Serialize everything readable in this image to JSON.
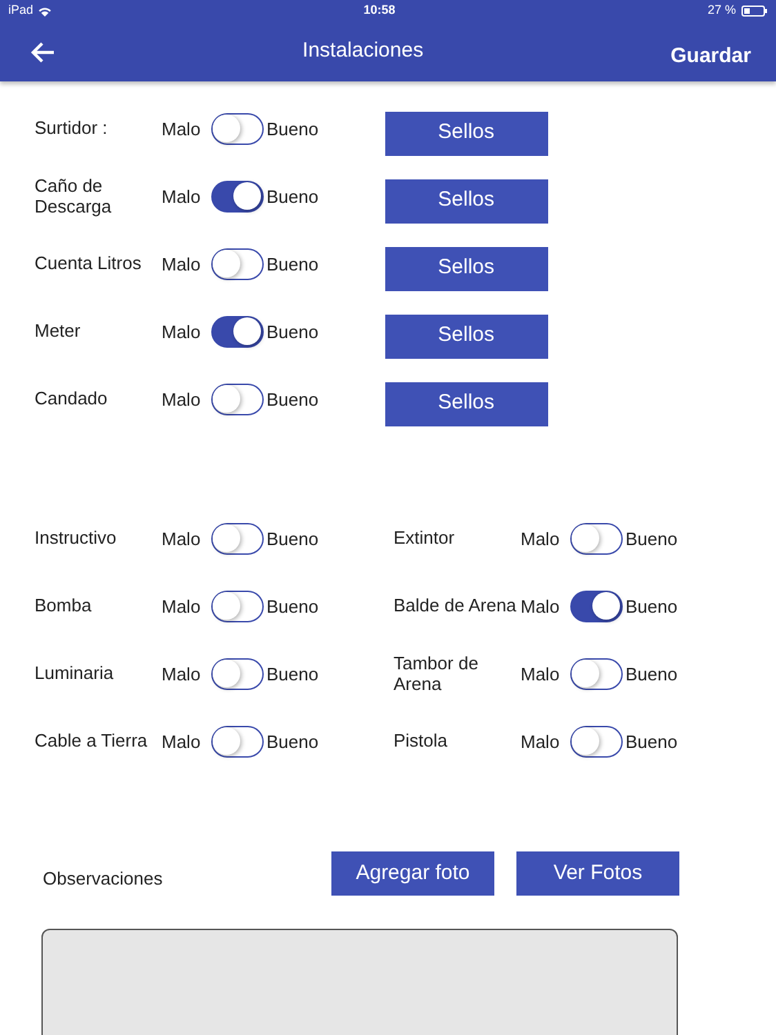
{
  "status_bar": {
    "device": "iPad",
    "time": "10:58",
    "battery": "27 %"
  },
  "header": {
    "title": "Instalaciones",
    "action": "Guardar"
  },
  "items": [
    {
      "label": "Surtidor :",
      "low": "Malo",
      "high": "Bueno",
      "on": false,
      "button": "Sellos"
    },
    {
      "label": "Caño de Descarga",
      "low": "Malo",
      "high": "Bueno",
      "on": true,
      "button": "Sellos"
    },
    {
      "label": "Cuenta Litros",
      "low": "Malo",
      "high": "Bueno",
      "on": false,
      "button": "Sellos"
    },
    {
      "label": "Meter",
      "low": "Malo",
      "high": "Bueno",
      "on": true,
      "button": "Sellos"
    },
    {
      "label": "Candado",
      "low": "Malo",
      "high": "Bueno",
      "on": false,
      "button": "Sellos"
    }
  ],
  "grid": [
    {
      "label": "Instructivo",
      "low": "Malo",
      "high": "Bueno",
      "on": false
    },
    {
      "label": "Extintor",
      "low": "Malo",
      "high": "Bueno",
      "on": false
    },
    {
      "label": "Bomba",
      "low": "Malo",
      "high": "Bueno",
      "on": false
    },
    {
      "label": "Balde de Arena",
      "low": "Malo",
      "high": "Bueno",
      "on": true
    },
    {
      "label": "Luminaria",
      "low": "Malo",
      "high": "Bueno",
      "on": false
    },
    {
      "label": "Tambor de Arena",
      "low": "Malo",
      "high": "Bueno",
      "on": false
    },
    {
      "label": "Cable a Tierra",
      "low": "Malo",
      "high": "Bueno",
      "on": false
    },
    {
      "label": "Pistola",
      "low": "Malo",
      "high": "Bueno",
      "on": false
    }
  ],
  "observations": {
    "label": "Observaciones",
    "buttons": [
      "Agregar foto",
      "Ver Fotos"
    ]
  }
}
